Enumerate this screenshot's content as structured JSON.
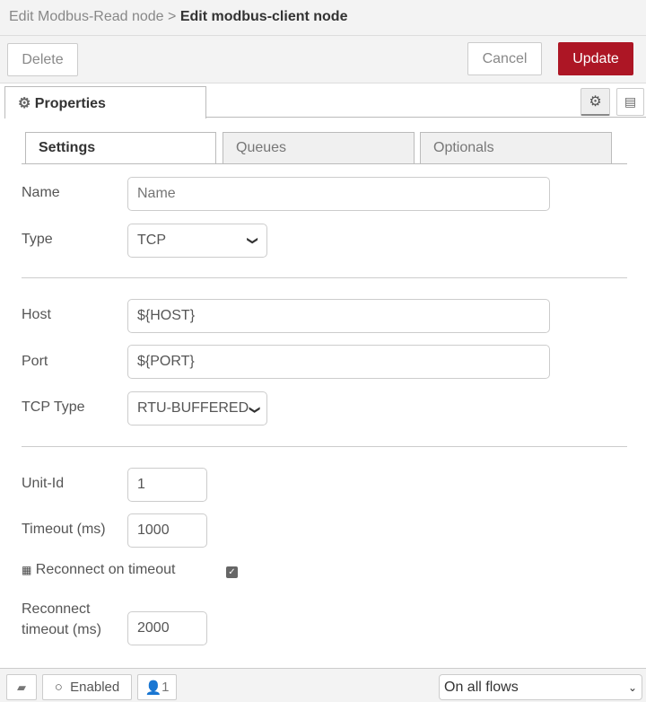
{
  "breadcrumb": {
    "parent": "Edit Modbus-Read node",
    "separator": ">",
    "current": "Edit modbus-client node"
  },
  "toolbar": {
    "delete": "Delete",
    "cancel": "Cancel",
    "update": "Update",
    "update_color": "#ad1625"
  },
  "tabs": {
    "properties": "Properties"
  },
  "subtabs": [
    "Settings",
    "Queues",
    "Optionals"
  ],
  "form": {
    "name": {
      "label": "Name",
      "value": "",
      "placeholder": "Name"
    },
    "type": {
      "label": "Type",
      "value": "TCP"
    },
    "host": {
      "label": "Host",
      "value": "${HOST}"
    },
    "port": {
      "label": "Port",
      "value": "${PORT}"
    },
    "tcp_type": {
      "label": "TCP Type",
      "value": "RTU-BUFFERED"
    },
    "unit_id": {
      "label": "Unit-Id",
      "value": "1"
    },
    "timeout": {
      "label": "Timeout (ms)",
      "value": "1000"
    },
    "reconnect_on_timeout": {
      "label": "Reconnect on timeout",
      "checked": true
    },
    "reconnect_timeout": {
      "label_line1": "Reconnect",
      "label_line2": "timeout (ms)",
      "value": "2000"
    }
  },
  "footer": {
    "enabled": "Enabled",
    "users": "1",
    "scope": "On all flows"
  }
}
